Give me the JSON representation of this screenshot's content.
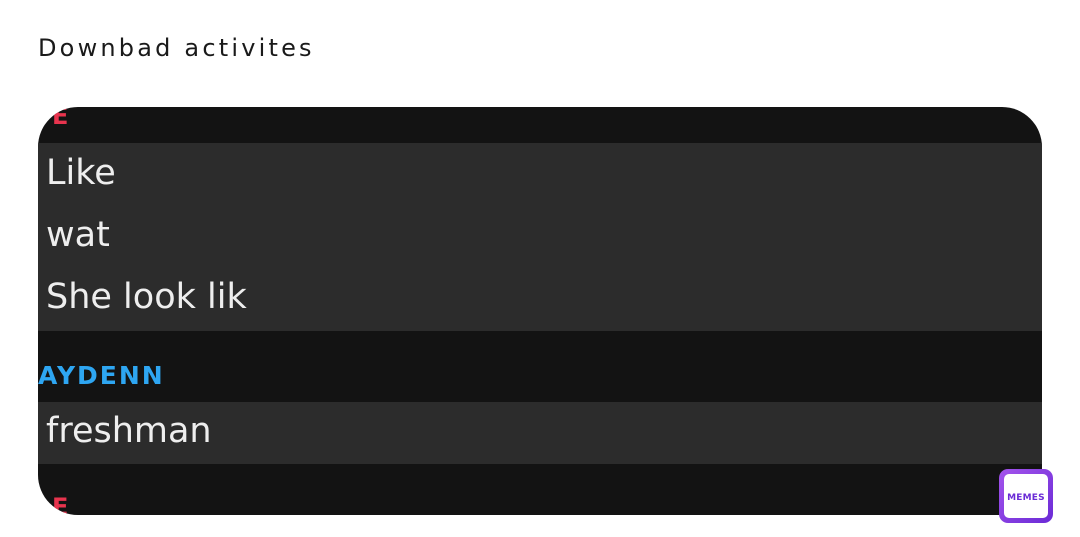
{
  "caption": "Downbad activites",
  "chat": {
    "top_sender_initial": "E",
    "first_block": {
      "lines": [
        "Like",
        "wat",
        "She look lik"
      ]
    },
    "second_sender": "AYDENN",
    "second_block": {
      "lines": [
        "freshman"
      ]
    },
    "bottom_sender_initial": "E"
  },
  "logo": {
    "text": "MEMES"
  },
  "colors": {
    "background": "#ffffff",
    "chat_background": "#131313",
    "message_background": "#2c2c2c",
    "message_text": "#eeeeee",
    "sender_red": "#e8344e",
    "sender_blue": "#2ea6f2",
    "logo_purple": "#7a35e0"
  }
}
